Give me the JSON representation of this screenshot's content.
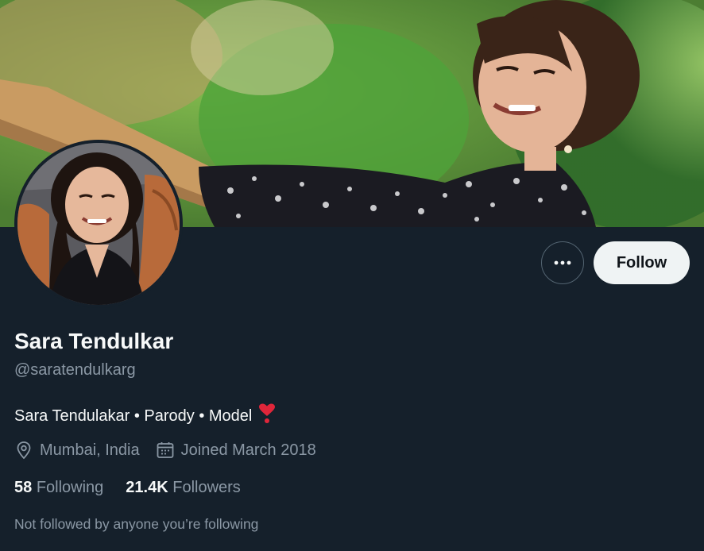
{
  "profile": {
    "name": "Sara Tendulkar",
    "handle": "@saratendulkarg",
    "bio": "Sara Tendulakar • Parody • Model",
    "location": "Mumbai, India",
    "joined": "Joined March 2018",
    "following_count": "58",
    "following_label": "Following",
    "followers_count": "21.4K",
    "followers_label": "Followers",
    "followed_by_note": "Not followed by anyone you’re following"
  },
  "actions": {
    "more_label": "•••",
    "follow_label": "Follow"
  },
  "icons": {
    "more": "more-icon",
    "location": "location-pin-icon",
    "calendar": "calendar-icon",
    "heart": "heart-emoji-icon"
  },
  "colors": {
    "background": "#15202b",
    "primary_text": "#f7f9f9",
    "secondary_text": "#8b98a5",
    "follow_button": "#eff3f4",
    "heart": "#e0263a"
  }
}
